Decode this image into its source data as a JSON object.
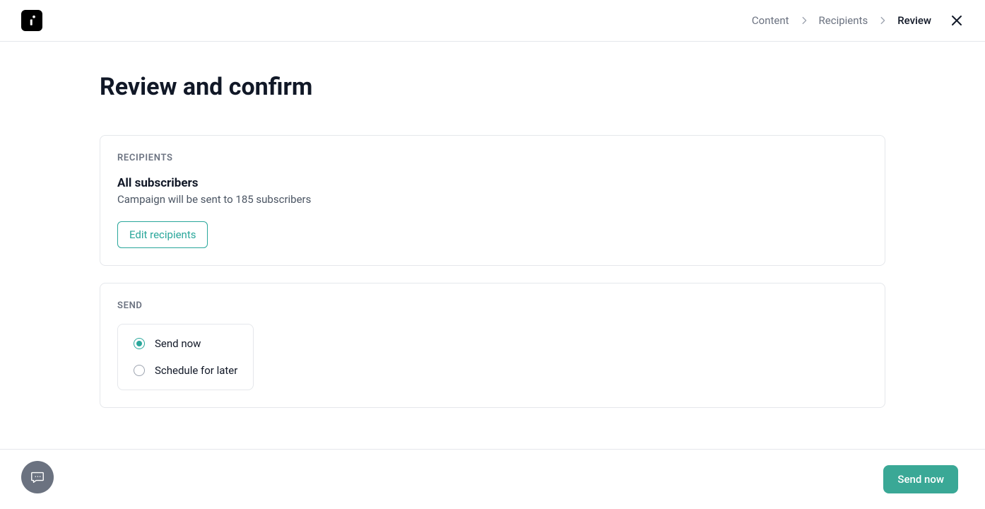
{
  "breadcrumbs": {
    "items": [
      {
        "label": "Content",
        "active": false
      },
      {
        "label": "Recipients",
        "active": false
      },
      {
        "label": "Review",
        "active": true
      }
    ]
  },
  "page": {
    "title": "Review and confirm"
  },
  "recipients_card": {
    "label": "RECIPIENTS",
    "title": "All subscribers",
    "description": "Campaign will be sent to 185 subscribers",
    "edit_button": "Edit recipients"
  },
  "send_card": {
    "label": "SEND",
    "options": [
      {
        "label": "Send now",
        "selected": true
      },
      {
        "label": "Schedule for later",
        "selected": false
      }
    ]
  },
  "footer": {
    "primary_button": "Send now"
  }
}
